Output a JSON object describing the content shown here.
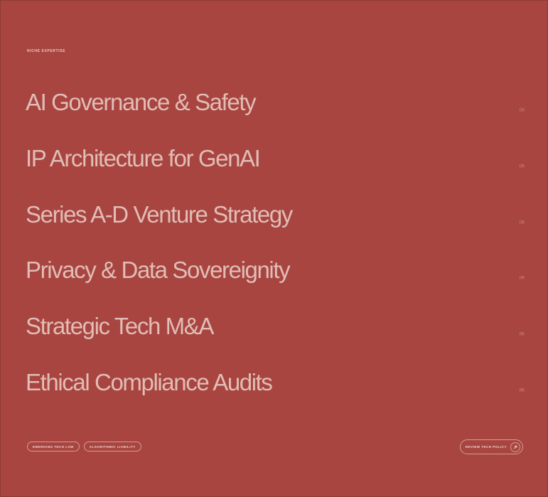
{
  "section": {
    "eyebrow": "NICHE EXPERTISE"
  },
  "items": [
    {
      "title": "AI Governance & Safety",
      "num": "(1)"
    },
    {
      "title": "IP Architecture for GenAI",
      "num": "(2)"
    },
    {
      "title": "Series A-D Venture Strategy",
      "num": "(3)"
    },
    {
      "title": "Privacy & Data Sovereignity",
      "num": "(4)"
    },
    {
      "title": "Strategic Tech M&A",
      "num": "(5)"
    },
    {
      "title": "Ethical Compliance Audits",
      "num": "(6)"
    }
  ],
  "footer": {
    "tags": [
      "EMERGING TECH LAW",
      "ALGORITHMIC LIABILITY"
    ],
    "cta_label": "REVIEW TECH POLICY",
    "cta_icon": "arrow-up-right-icon"
  },
  "colors": {
    "background": "#a84540",
    "text": "#e2bcb6",
    "border": "#d79c95"
  }
}
